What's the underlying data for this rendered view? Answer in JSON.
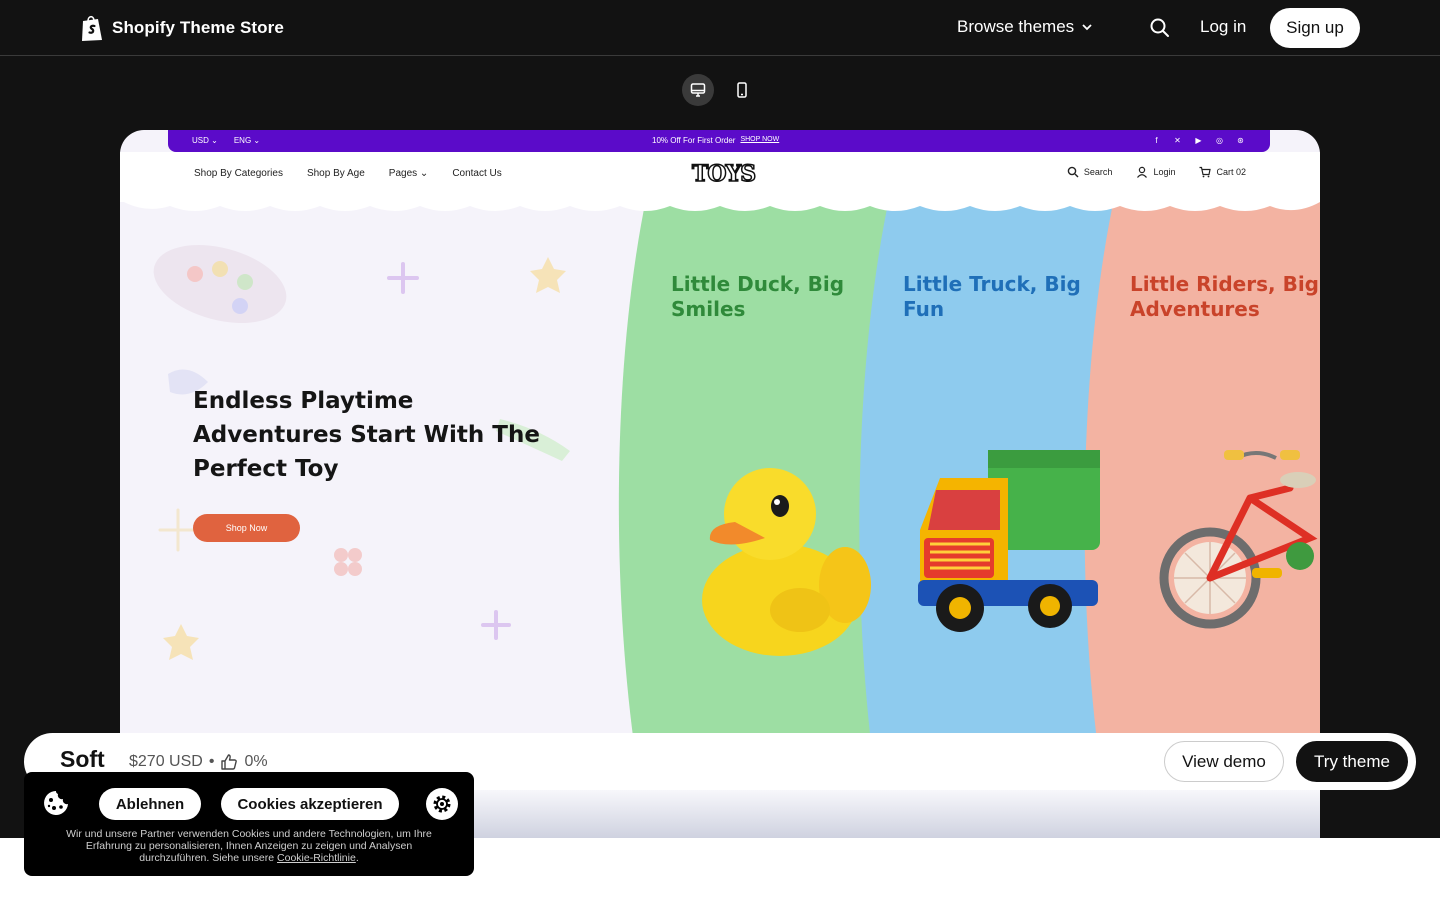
{
  "header": {
    "brand_name": "Shopify Theme Store",
    "browse_label": "Browse themes",
    "login_label": "Log in",
    "signup_label": "Sign up"
  },
  "preview": {
    "promo": {
      "currency": "USD",
      "language": "ENG",
      "message": "10% Off For First Order",
      "link": "SHOP NOW"
    },
    "nav": {
      "items": [
        "Shop By Categories",
        "Shop By Age",
        "Pages",
        "Contact Us"
      ],
      "logo": "TOYS",
      "search": "Search",
      "login": "Login",
      "cart": "Cart 02"
    },
    "hero": {
      "title_lines": [
        "Endless Playtime",
        "Adventures Start With The",
        "Perfect Toy"
      ],
      "button": "Shop Now"
    },
    "panels": [
      {
        "title_lines": [
          "Little Duck, Big",
          "Smiles"
        ],
        "color": "#9ddea3",
        "text_color": "#2f8a3a"
      },
      {
        "title_lines": [
          "Little Truck, Big",
          "Fun"
        ],
        "color": "#8ecbee",
        "text_color": "#1f6fb8"
      },
      {
        "title_lines": [
          "Little Riders, Big",
          "Adventures"
        ],
        "color": "#f3b3a2",
        "text_color": "#c9432a"
      }
    ],
    "promo_color": "#5b0bc9",
    "button_color": "#e0633f"
  },
  "theme": {
    "name": "Soft",
    "price": "$270 USD",
    "separator": "•",
    "rating": "0%",
    "view_demo": "View demo",
    "try_theme": "Try theme"
  },
  "cookie": {
    "reject": "Ablehnen",
    "accept": "Cookies akzeptieren",
    "text": "Wir und unsere Partner verwenden Cookies und andere Technologien, um Ihre Erfahrung zu personalisieren, Ihnen Anzeigen zu zeigen und Analysen durchzuführen. Siehe unsere",
    "link": "Cookie-Richtlinie",
    "end": "."
  }
}
